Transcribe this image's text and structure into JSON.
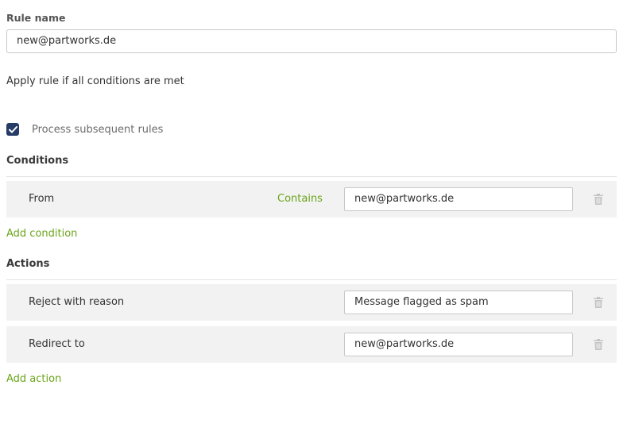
{
  "rule_name": {
    "label": "Rule name",
    "value": "new@partworks.de"
  },
  "apply_text": "Apply rule if all conditions are met",
  "process_subsequent": {
    "label": "Process subsequent rules",
    "checked": true
  },
  "conditions": {
    "title": "Conditions",
    "items": [
      {
        "field": "From",
        "operator": "Contains",
        "value": "new@partworks.de"
      }
    ],
    "add_label": "Add condition"
  },
  "actions": {
    "title": "Actions",
    "items": [
      {
        "action": "Reject with reason",
        "value": "Message flagged as spam"
      },
      {
        "action": "Redirect to",
        "value": "new@partworks.de"
      }
    ],
    "add_label": "Add action"
  },
  "colors": {
    "accent_green": "#6aa519",
    "checkbox_navy": "#253c66",
    "row_background": "#f2f2f2"
  },
  "icons": {
    "checkbox": "check-icon",
    "delete": "trash-icon"
  }
}
